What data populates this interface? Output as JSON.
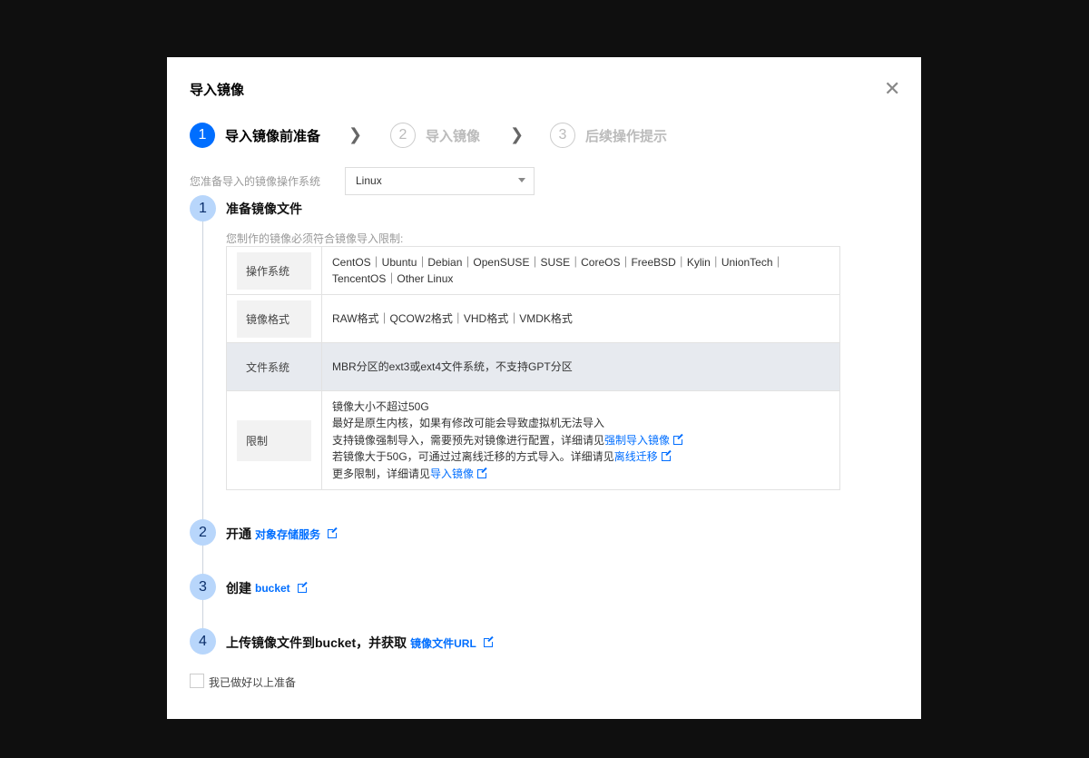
{
  "dialog": {
    "title": "导入镜像",
    "close_icon": "close-icon"
  },
  "steps": [
    {
      "num": "1",
      "label": "导入镜像前准备",
      "active": true
    },
    {
      "num": "2",
      "label": "导入镜像",
      "active": false
    },
    {
      "num": "3",
      "label": "后续操作提示",
      "active": false
    }
  ],
  "os": {
    "label": "您准备导入的镜像操作系统",
    "value": "Linux"
  },
  "prep": {
    "s1": {
      "num": "1",
      "title": "准备镜像文件",
      "desc": "您制作的镜像必须符合镜像导入限制:"
    },
    "table": [
      {
        "key": "操作系统",
        "lines": [
          "CentOS｜Ubuntu｜Debian｜OpenSUSE｜SUSE｜CoreOS｜FreeBSD｜Kylin｜UnionTech｜",
          "TencentOS｜Other Linux"
        ]
      },
      {
        "key": "镜像格式",
        "lines": [
          "RAW格式｜QCOW2格式｜VHD格式｜VMDK格式"
        ]
      },
      {
        "key": "文件系统",
        "lines": [
          "MBR分区的ext3或ext4文件系统，不支持GPT分区"
        ]
      },
      {
        "key": "限制",
        "lines": [
          "镜像大小不超过50G",
          "最好是原生内核，如果有修改可能会导致虚拟机无法导入",
          "支持镜像强制导入，需要预先对镜像进行配置，详细请见",
          "若镜像大于50G，可通过过离线迁移的方式导入。详细请见",
          "更多限制，详细请见"
        ],
        "links": [
          "强制导入镜像",
          "离线迁移",
          "导入镜像"
        ]
      }
    ],
    "s2": {
      "num": "2",
      "title": "开通",
      "link": "对象存储服务"
    },
    "s3": {
      "num": "3",
      "title": "创建",
      "link": "bucket"
    },
    "s4": {
      "num": "4",
      "title": "上传镜像文件到bucket，并获取",
      "link": "镜像文件URL"
    }
  },
  "confirm": {
    "label": "我已做好以上准备",
    "checked": false
  },
  "colors": {
    "primary": "#006eff",
    "step_circle": "#b8d6fb"
  }
}
